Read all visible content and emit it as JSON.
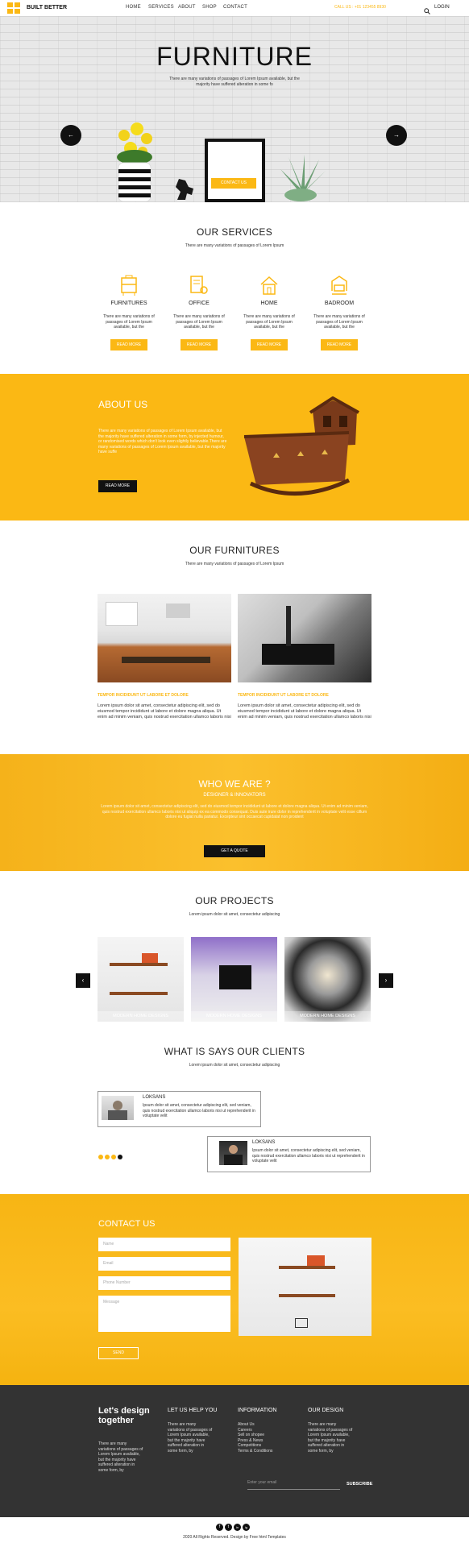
{
  "brand": {
    "name": "BUILT BETTER",
    "accent": "#fbb814",
    "dark": "#111111",
    "footer_bg": "#333333"
  },
  "nav": {
    "items": [
      "HOME",
      "SERVICES",
      "ABOUT",
      "SHOP",
      "CONTACT"
    ],
    "phone": "CALL US : +01 123455 8930",
    "login": "LOGIN"
  },
  "hero": {
    "title": "FURNITURE",
    "subtitle": "There are many variations of passages of Lorem Ipsum available, but the majority have suffered alteration in some fo",
    "button": "CONTACT US",
    "prev": "←",
    "next": "→"
  },
  "services": {
    "title": "OUR SERVICES",
    "subtitle": "There are many variations of passages of Lorem Ipsum",
    "items": [
      {
        "name": "FURNITURES",
        "text": "There are many variations of passages of Lorem Ipsum available, but the",
        "button": "READ MORE",
        "icon": "furniture-icon"
      },
      {
        "name": "OFFICE",
        "text": "There are many variations of passages of Lorem Ipsum available, but the",
        "button": "READ MORE",
        "icon": "office-icon"
      },
      {
        "name": "HOME",
        "text": "There are many variations of passages of Lorem Ipsum available, but the",
        "button": "READ MORE",
        "icon": "home-icon"
      },
      {
        "name": "BADROOM",
        "text": "There are many variations of passages of Lorem Ipsum available, but the",
        "button": "READ MORE",
        "icon": "bedroom-icon"
      }
    ]
  },
  "about": {
    "title": "ABOUT US",
    "text": "There are many variations of passages of Lorem Ipsum available, but the majority have suffered alteration in some form, by injected humour, or randomised words which don't look even slightly believable.There are many variations of passages of Lorem Ipsum available, but the majority have suffe",
    "button": "READ MORE"
  },
  "furnitures": {
    "title": "OUR FURNITURES",
    "subtitle": "There are many variations of passages of Lorem Ipsum",
    "items": [
      {
        "heading": "TEMPOR INCIDIDUNT UT LABORE ET DOLORE",
        "text": "Lorem ipsum dolor sit amet, consectetur adipiscing elit, sed do eiusmod tempor incididunt ut labore et dolore magna aliqua. Ut enim ad minim veniam, quis nostrud exercitation ullamco laboris nisi"
      },
      {
        "heading": "TEMPOR INCIDIDUNT UT LABORE ET DOLORE",
        "text": "Lorem ipsum dolor sit amet, consectetur adipiscing elit, sed do eiusmod tempor incididunt ut labore et dolore magna aliqua. Ut enim ad minim veniam, quis nostrud exercitation ullamco laboris nisi"
      }
    ]
  },
  "who": {
    "title": "WHO WE ARE ?",
    "subtitle": "DESIGNER & INNOVATORS",
    "text": "Lorem ipsum dolor sit amet, consectetur adipiscing elit, sed do eiusmod tempor incididunt ut labore et dolore magna aliqua. Ut enim ad minim veniam, quis nostrud exercitation ullamco laboris nisi ut aliquip ex ea commodo consequat. Duis aute irure dolor in reprehenderit in voluptate velit esse cillum dolore eu fugiat nulla pariatur. Excepteur sint occaecat cupidatat non proident",
    "button": "GET A QUOTE"
  },
  "projects": {
    "title": "OUR PROJECTS",
    "subtitle": "Lorem ipsum dolor sit amet, consectetur adipiscing",
    "items": [
      "MODERN HOME DESIGNS",
      "MODERN HOME DESIGNS",
      "MODERN HOME DESIGNS"
    ],
    "prev": "‹",
    "next": "›"
  },
  "clients": {
    "title": "WHAT IS SAYS OUR CLIENTS",
    "subtitle": "Lorem ipsum dolor sit amet, consectetur adipiscing",
    "items": [
      {
        "name": "LOKSANS",
        "text": "Ipsum dolor sit amet, consectetur adipiscing elit, sed veniam, quis nostrud exercitation ullamco laboris nisi ut reprehenderit in voluptate velit"
      },
      {
        "name": "LOKSANS",
        "text": "Ipsum dolor sit amet, consectetur adipiscing elit, sed veniam, quis nostrud exercitation ullamco laboris nisi ut reprehenderit in voluptate velit"
      }
    ]
  },
  "contact": {
    "title": "CONTACT US",
    "placeholders": {
      "name": "Name",
      "email": "Email",
      "phone": "Phone Number",
      "message": "Message"
    },
    "button": "SEND"
  },
  "footer": {
    "tagline": "Let's design together",
    "about_text": "There are many variations of passages of Lorem Ipsum available, but the majority have suffered alteration in some form, by",
    "col2": {
      "title": "LET US HELP YOU",
      "text": "There are many variations of passages of Lorem Ipsum available, but the majority have suffered alteration in some form, by"
    },
    "col3": {
      "title": "INFORMATION",
      "links": [
        "About Us",
        "Careers",
        "Sell on shopee",
        "Press & News",
        "Competitions",
        "Terms & Conditions"
      ]
    },
    "col4": {
      "title": "OUR DESIGN",
      "text": "There are many variations of passages of Lorem Ipsum available, but the majority have suffered alteration in some form, by"
    },
    "email_placeholder": "Enter your email",
    "subscribe": "SUBSCRIBE"
  },
  "bottom": {
    "social": [
      "f",
      "t",
      "in",
      "ig"
    ],
    "copyright": "2020 All Rights Reserved. Design by Free html Templates"
  }
}
